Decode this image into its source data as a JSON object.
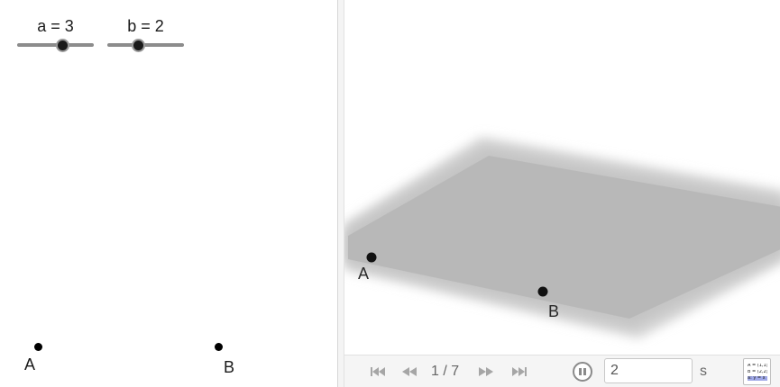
{
  "sliders": {
    "a": {
      "label": "a = 3",
      "value": 3,
      "fraction": 0.59
    },
    "b": {
      "label": "b = 2",
      "value": 2,
      "fraction": 0.4
    }
  },
  "graphics2d": {
    "points": [
      {
        "name": "A"
      },
      {
        "name": "B"
      }
    ]
  },
  "graphics3d": {
    "plane_color": "#b8b8b8",
    "points": [
      {
        "name": "A"
      },
      {
        "name": "B"
      }
    ]
  },
  "animation": {
    "page_indicator": "1 / 7",
    "speed_value": "2",
    "speed_unit": "s",
    "buttons": [
      "first-icon",
      "previous-icon",
      "next-icon",
      "last-icon",
      "pause-icon"
    ],
    "algebra_icon_rows": [
      "A = (1,1)",
      "B = (2,2)",
      "a: y = x"
    ]
  }
}
